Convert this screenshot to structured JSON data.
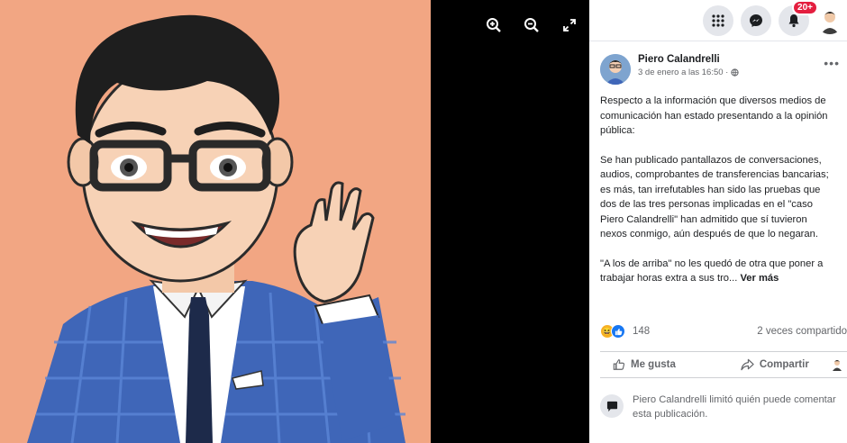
{
  "viewer": {
    "controls": [
      "zoom-in",
      "zoom-out",
      "fullscreen"
    ]
  },
  "topbar": {
    "icons": [
      "menu-grid-icon",
      "messenger-icon",
      "bell-icon"
    ],
    "notification_badge": "20+"
  },
  "post": {
    "author": "Piero Calandrelli",
    "timestamp": "3 de enero a las 16:50 ·",
    "more_label": "•••",
    "paragraph1": "Respecto a la información que diversos medios de comunicación han estado presentando a la opinión pública:",
    "paragraph2": "Se han publicado pantallazos de conversaciones, audios, comprobantes de transferencias bancarias; es más, tan irrefutables han sido las pruebas que dos de las tres personas implicadas en el \"caso Piero Calandrelli\" han admitido que sí tuvieron nexos conmigo, aún después de que lo negaran.",
    "paragraph3": "\"A los de arriba\" no les quedó de otra que poner a trabajar horas extra a sus tro...",
    "see_more": "Ver más"
  },
  "reactions": {
    "count": "148",
    "shares": "2 veces compartido"
  },
  "actions": {
    "like": "Me gusta",
    "share": "Compartir"
  },
  "comment_notice": {
    "text": "Piero Calandrelli limitó quién puede comentar esta publicación."
  },
  "colors": {
    "photo_background": "#f2a683",
    "badge": "#e41e3f",
    "like_blue": "#1877f2"
  }
}
